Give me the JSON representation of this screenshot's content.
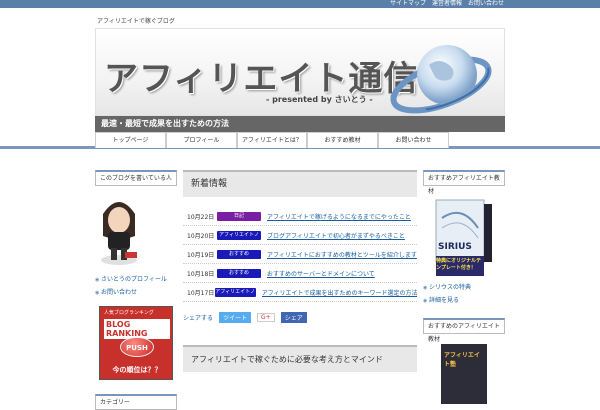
{
  "header": {
    "toplinks": [
      "サイトマップ",
      "運営者情報",
      "お問い合わせ"
    ],
    "tagline": "アフィリエイトで稼ぐブログ",
    "logo_text": "アフィリエイト通信",
    "byline": "- presented by さいとう -",
    "catchphrase": "最速・最短で成果を出すための方法"
  },
  "nav": {
    "items": [
      "トップページ",
      "プロフィール",
      "アフィリエイトとは？",
      "おすすめ教材",
      "お問い合わせ"
    ]
  },
  "left_sidebar": {
    "profile_title": "このブログを書いている人",
    "links": [
      "さいとうのプロフィール",
      "お問い合わせ"
    ],
    "ranking_brand": "BLOG RANKING",
    "ranking_sub": "人気ブログランキング",
    "ranking_push": "PUSH",
    "ranking_caption": "今の順位は？？",
    "category_title": "カテゴリー"
  },
  "main": {
    "news_title": "新着情報",
    "news": [
      {
        "date": "10月22日",
        "category": "日記",
        "color": "#7a1fa2",
        "title": "アフィリエイトで稼げるようになるまでにやったこと"
      },
      {
        "date": "10月20日",
        "category": "アフィリエイトノウハウ",
        "color": "#1a1ab8",
        "title": "ブログアフィリエイトで初心者がまずやるべきこと"
      },
      {
        "date": "10月19日",
        "category": "おすすめ",
        "color": "#1a1ab8",
        "title": "アフィリエイトにおすすめの教材とツールを紹介します"
      },
      {
        "date": "10月18日",
        "category": "おすすめ",
        "color": "#1a1ab8",
        "title": "おすすめのサーバーとドメインについて"
      },
      {
        "date": "10月17日",
        "category": "アフィリエイトノウハウ",
        "color": "#1a1ab8",
        "title": "アフィリエイトで成果を出すためのキーワード選定の方法と..."
      }
    ],
    "share": {
      "label": "シェアする",
      "tw": "ツイート",
      "gp": "G+",
      "fb": "シェア"
    },
    "second_title": "アフィリエイトで稼ぐために必要な考え方とマインド"
  },
  "right_sidebar": {
    "title1": "おすすめアフィリエイト教材",
    "product_name": "SIRIUS",
    "product_badge": "特典にオリジナルテンプレート付き！",
    "links": [
      "シリウスの特典",
      "詳細を見る"
    ],
    "title2": "おすすめのアフィリエイト教材",
    "product2_name": "アフィリエイト塾"
  },
  "colors": {
    "accent": "#7797bb",
    "catch_bg": "#666666",
    "ranking_red": "#c8302c"
  }
}
